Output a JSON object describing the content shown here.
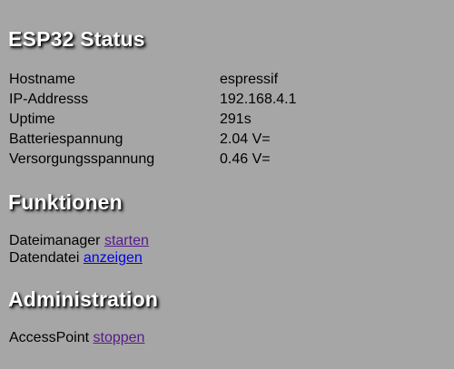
{
  "title": "ESP32 Status",
  "status_rows": [
    {
      "key": "Hostname",
      "value": "espressif"
    },
    {
      "key": "IP-Addresss",
      "value": "192.168.4.1"
    },
    {
      "key": "Uptime",
      "value": "291s"
    },
    {
      "key": "Batteriespannung",
      "value": "2.04 V="
    },
    {
      "key": "Versorgungsspannung",
      "value": "0.46 V="
    }
  ],
  "funktionen": {
    "heading": "Funktionen",
    "dateimanager": {
      "label": "Dateimanager",
      "link": "starten"
    },
    "datendatei": {
      "label": "Datendatei",
      "link": "anzeigen"
    }
  },
  "administration": {
    "heading": "Administration",
    "accesspoint": {
      "label": "AccessPoint",
      "link": "stoppen"
    }
  },
  "colors": {
    "background": "#a6a6a6",
    "heading": "#ffffff",
    "link": "#0000ee",
    "visited_link": "#551a8b"
  }
}
